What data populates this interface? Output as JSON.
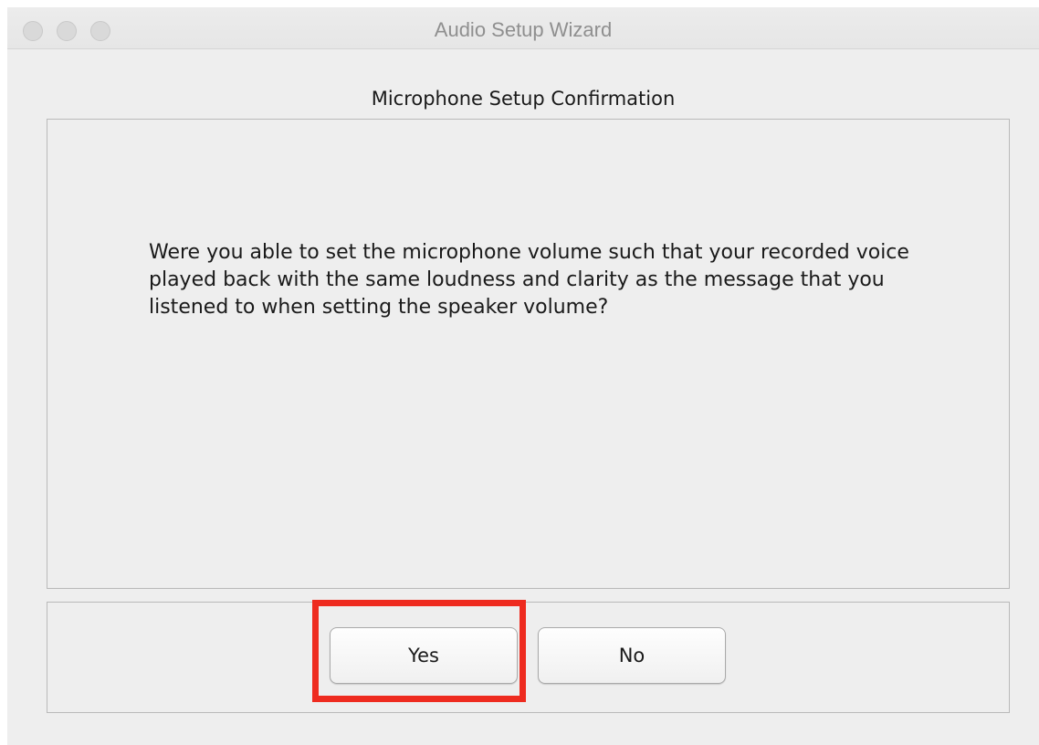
{
  "window": {
    "title": "Audio Setup Wizard"
  },
  "page": {
    "section_title": "Microphone Setup Confirmation",
    "message": "Were you able to set the microphone volume such that your recorded voice played back with the same loudness and clarity as the message that you listened to when setting the speaker volume?"
  },
  "buttons": {
    "yes_label": "Yes",
    "no_label": "No"
  },
  "highlight": {
    "color": "#ee2b1f",
    "target": "yes-button"
  }
}
